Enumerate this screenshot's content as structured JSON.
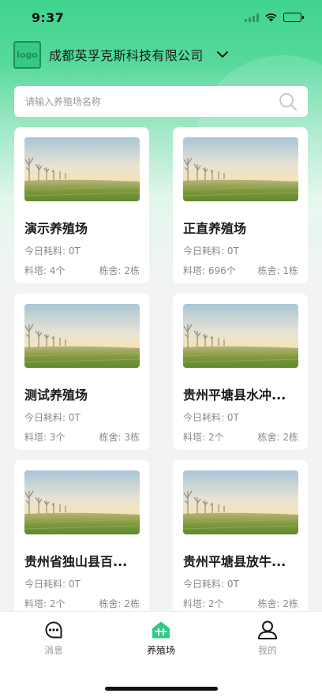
{
  "status_bar": {
    "time": "9:37"
  },
  "header": {
    "logo_text": "logo",
    "company": "成都英孚克斯科技有限公司"
  },
  "search": {
    "placeholder": "请输入养殖场名称"
  },
  "farms": [
    {
      "name": "演示养殖场",
      "feed": "今日耗料: 0T",
      "towers": "料塔: 4个",
      "barns": "栋舍: 2栋"
    },
    {
      "name": "正直养殖场",
      "feed": "今日耗料: 0T",
      "towers": "料塔: 696个",
      "barns": "栋舍: 1栋"
    },
    {
      "name": "测试养殖场",
      "feed": "今日耗料: 0T",
      "towers": "料塔: 3个",
      "barns": "栋舍: 3栋"
    },
    {
      "name": "贵州平塘县水冲...",
      "feed": "今日耗料: 0T",
      "towers": "料塔: 2个",
      "barns": "栋舍: 2栋"
    },
    {
      "name": "贵州省独山县百...",
      "feed": "今日耗料: 0T",
      "towers": "料塔: 2个",
      "barns": "栋舍: 2栋"
    },
    {
      "name": "贵州平塘县放牛...",
      "feed": "今日耗料: 0T",
      "towers": "料塔: 2个",
      "barns": "栋舍: 2栋"
    }
  ],
  "tabbar": {
    "items": [
      {
        "label": "消息",
        "icon": "message-icon",
        "active": false
      },
      {
        "label": "养殖场",
        "icon": "farm-icon",
        "active": true
      },
      {
        "label": "我的",
        "icon": "profile-icon",
        "active": false
      }
    ]
  },
  "colors": {
    "accent": "#2ecb83",
    "accent_light": "#55d99b",
    "text_secondary": "#8a8a8a",
    "background": "#f2f4f3"
  }
}
